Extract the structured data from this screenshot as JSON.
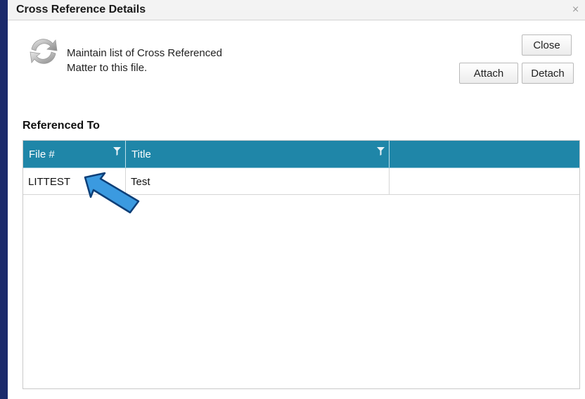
{
  "window": {
    "title": "Cross Reference Details",
    "close_glyph": "⨯"
  },
  "header": {
    "icon": "refresh-cycle-icon",
    "description_line1": "Maintain list of Cross Referenced",
    "description_line2": "Matter to this file."
  },
  "buttons": {
    "close": "Close",
    "attach": "Attach",
    "detach": "Detach"
  },
  "section": {
    "label": "Referenced To"
  },
  "grid": {
    "columns": [
      "File #",
      "Title",
      ""
    ],
    "rows": [
      {
        "file": "LITTEST",
        "title": "Test",
        "extra": ""
      }
    ]
  },
  "annotation": {
    "icon": "pointer-arrow-icon"
  },
  "colors": {
    "grid_header": "#1f86a8",
    "arrow_fill": "#3b9ae0",
    "frame": "#1b2a6b"
  }
}
